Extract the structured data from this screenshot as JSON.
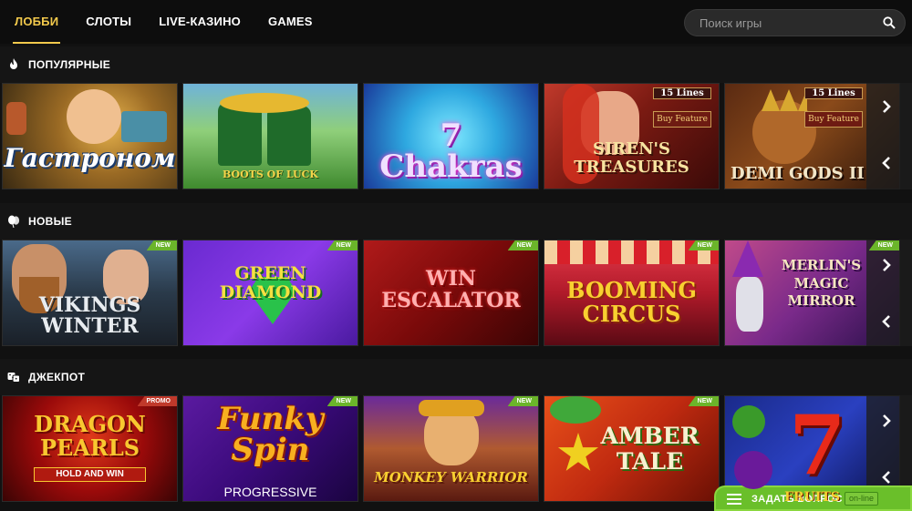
{
  "nav": {
    "items": [
      "ЛОББИ",
      "СЛОТЫ",
      "LIVE-КАЗИНО",
      "GAMES"
    ],
    "active_index": 0
  },
  "search": {
    "placeholder": "Поиск игры"
  },
  "sections": [
    {
      "title": "ПОПУЛЯРНЫЕ",
      "icon": "fire-icon",
      "games": [
        {
          "title": "Гастроном",
          "badge": ""
        },
        {
          "title": "BOOTS OF LUCK",
          "badge": ""
        },
        {
          "title": "7 Chakras",
          "badge": ""
        },
        {
          "title": "SIREN'S TREASURES",
          "badge": "",
          "lines": "15 Lines",
          "feature": "Buy Feature"
        },
        {
          "title": "DEMI GODS II",
          "badge": "",
          "lines": "15 Lines",
          "feature": "Buy Feature"
        }
      ]
    },
    {
      "title": "НОВЫЕ",
      "icon": "balloon-icon",
      "games": [
        {
          "title": "VIKINGS WINTER",
          "badge": "NEW"
        },
        {
          "title": "GREEN DIAMOND",
          "badge": "NEW"
        },
        {
          "title": "WIN ESCALATOR",
          "badge": "NEW"
        },
        {
          "title": "BOOMING CIRCUS",
          "badge": "NEW"
        },
        {
          "title": "MERLIN'S MAGIC MIRROR",
          "badge": "NEW"
        }
      ]
    },
    {
      "title": "ДЖЕКПОТ",
      "icon": "dice-icon",
      "games": [
        {
          "title": "DRAGON PEARLS",
          "subtitle": "HOLD AND WIN",
          "badge": "PROMO"
        },
        {
          "title": "Funky Spin",
          "subtitle": "PROGRESSIVE",
          "badge": "NEW"
        },
        {
          "title": "MONKEY WARRIOR",
          "badge": "NEW"
        },
        {
          "title": "AMBER TALE",
          "badge": "NEW"
        },
        {
          "title": "FRUITS",
          "badge": ""
        }
      ]
    }
  ],
  "chat": {
    "label": "ЗАДАТЬ ВОПРОС",
    "status": "on-line"
  },
  "colors": {
    "accent": "#f2c94c",
    "new_badge": "#6bb52a",
    "promo_badge": "#c0392b",
    "chat": "#6abf2a"
  }
}
